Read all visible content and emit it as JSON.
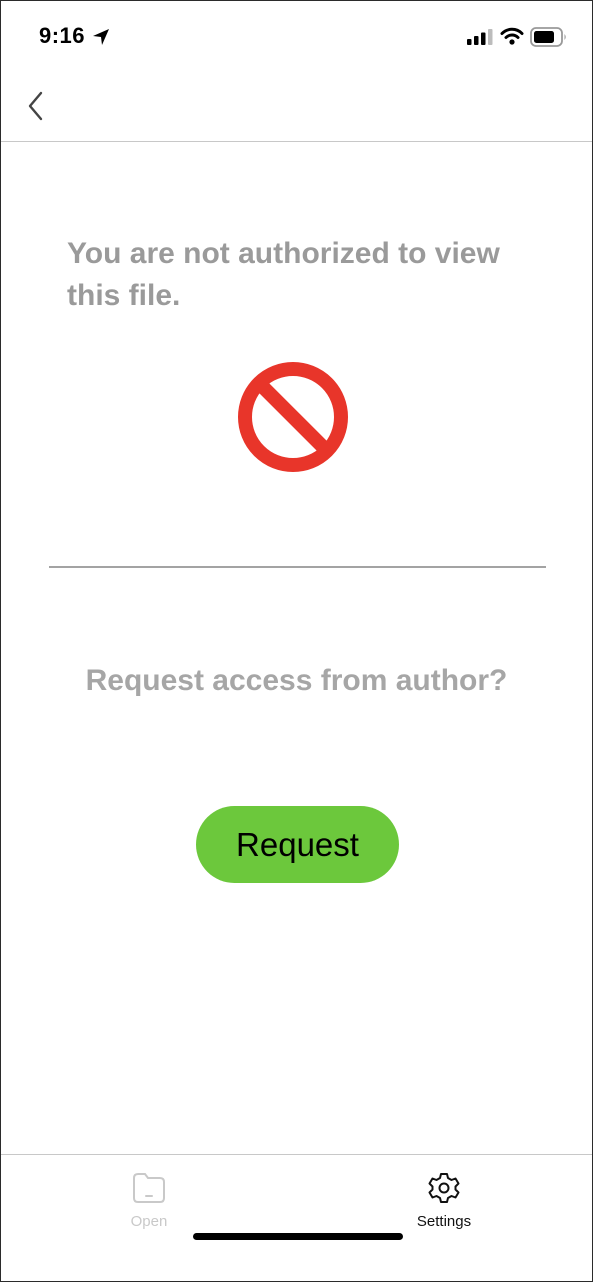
{
  "status_bar": {
    "time": "9:16"
  },
  "nav": {
    "back_icon": "chevron-left-icon"
  },
  "content": {
    "message": "You are not authorized to view this file.",
    "blocked_icon": "prohibited-icon",
    "question": "Request access from author?",
    "request_label": "Request"
  },
  "colors": {
    "accent_green": "#6cc83c",
    "prohibited_red": "#e8352a",
    "muted_text": "#9a9a9a"
  },
  "tab_bar": {
    "tabs": [
      {
        "label": "Open",
        "icon": "folder-icon",
        "active": false
      },
      {
        "label": "Settings",
        "icon": "gear-icon",
        "active": true
      }
    ]
  }
}
